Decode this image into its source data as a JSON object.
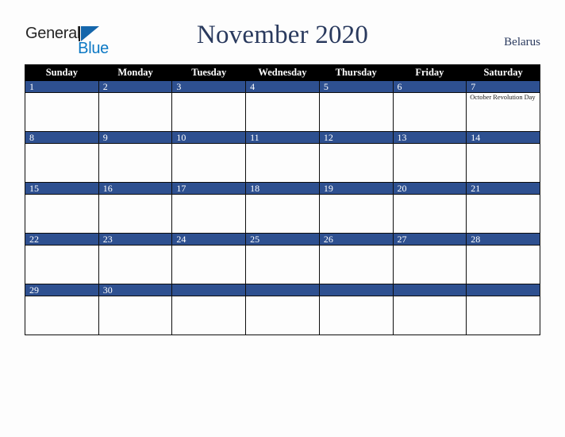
{
  "logo": {
    "word_primary": "General",
    "word_secondary": "Blue",
    "primary_color": "#262626",
    "secondary_color": "#0b78c4",
    "triangle_color": "#1566ab"
  },
  "header": {
    "title": "November 2020",
    "country": "Belarus",
    "title_color": "#2a3a5e"
  },
  "calendar": {
    "month": "November",
    "year": "2020",
    "header_bg": "#000000",
    "daynum_bg": "#2e5090",
    "grid_color": "#0d0d0d",
    "weekdays": [
      "Sunday",
      "Monday",
      "Tuesday",
      "Wednesday",
      "Thursday",
      "Friday",
      "Saturday"
    ],
    "weeks": [
      [
        {
          "day": "1",
          "events": []
        },
        {
          "day": "2",
          "events": []
        },
        {
          "day": "3",
          "events": []
        },
        {
          "day": "4",
          "events": []
        },
        {
          "day": "5",
          "events": []
        },
        {
          "day": "6",
          "events": []
        },
        {
          "day": "7",
          "events": [
            "October Revolution Day"
          ]
        }
      ],
      [
        {
          "day": "8",
          "events": []
        },
        {
          "day": "9",
          "events": []
        },
        {
          "day": "10",
          "events": []
        },
        {
          "day": "11",
          "events": []
        },
        {
          "day": "12",
          "events": []
        },
        {
          "day": "13",
          "events": []
        },
        {
          "day": "14",
          "events": []
        }
      ],
      [
        {
          "day": "15",
          "events": []
        },
        {
          "day": "16",
          "events": []
        },
        {
          "day": "17",
          "events": []
        },
        {
          "day": "18",
          "events": []
        },
        {
          "day": "19",
          "events": []
        },
        {
          "day": "20",
          "events": []
        },
        {
          "day": "21",
          "events": []
        }
      ],
      [
        {
          "day": "22",
          "events": []
        },
        {
          "day": "23",
          "events": []
        },
        {
          "day": "24",
          "events": []
        },
        {
          "day": "25",
          "events": []
        },
        {
          "day": "26",
          "events": []
        },
        {
          "day": "27",
          "events": []
        },
        {
          "day": "28",
          "events": []
        }
      ],
      [
        {
          "day": "29",
          "events": []
        },
        {
          "day": "30",
          "events": []
        },
        {
          "day": "",
          "events": []
        },
        {
          "day": "",
          "events": []
        },
        {
          "day": "",
          "events": []
        },
        {
          "day": "",
          "events": []
        },
        {
          "day": "",
          "events": []
        }
      ]
    ]
  }
}
